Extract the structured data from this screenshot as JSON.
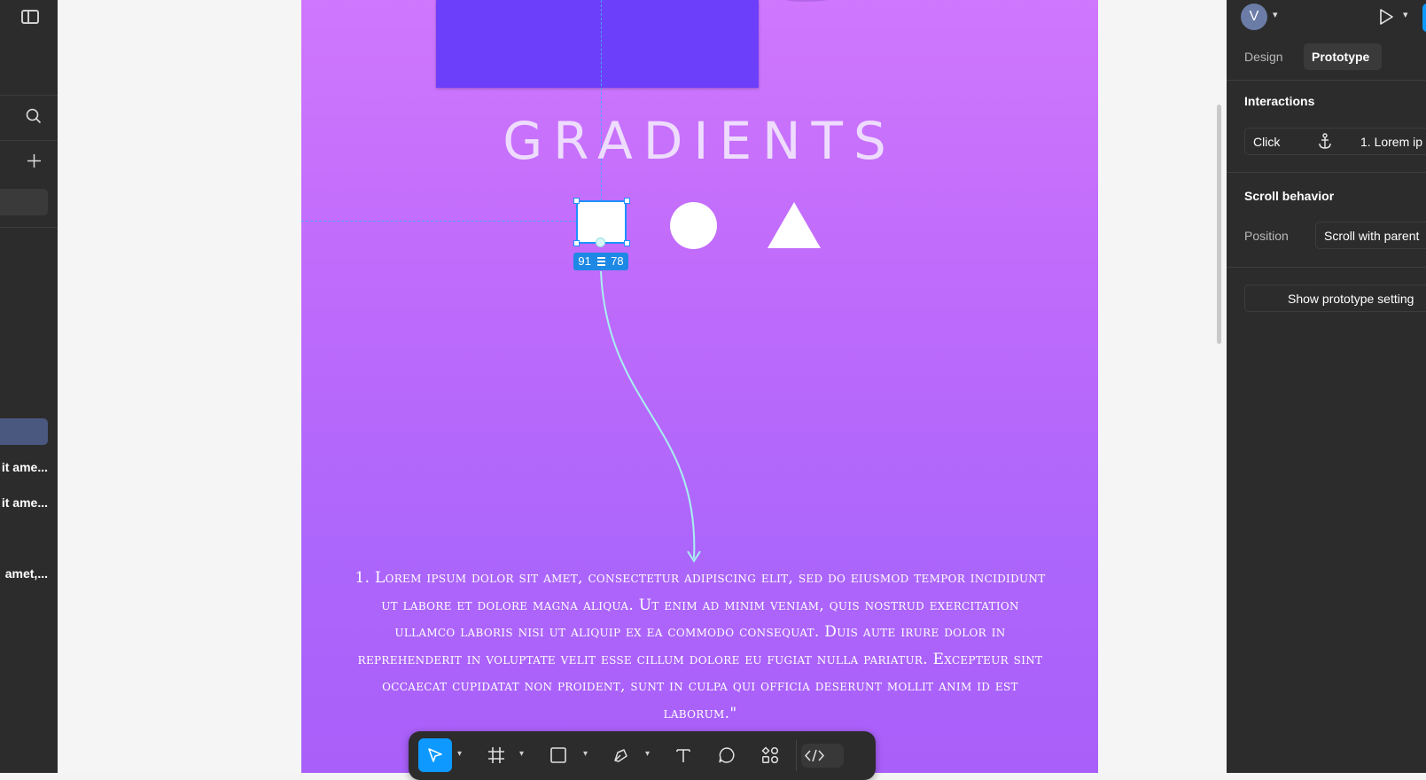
{
  "left_panel": {
    "items": [
      {
        "label": "it ame..."
      },
      {
        "label": "it ame..."
      },
      {
        "label": "amet,..."
      }
    ]
  },
  "canvas": {
    "frame_title": "GRADIENTS",
    "size_badge": {
      "width": "91",
      "height": "78"
    },
    "body_text": "1. Lorem ipsum dolor sit amet, consectetur adipiscing elit, sed do eiusmod tempor incididunt ut labore et dolore magna aliqua. Ut enim ad minim veniam, quis nostrud exercitation ullamco laboris nisi ut aliquip ex ea commodo consequat. Duis aute irure dolor in reprehenderit in voluptate velit esse cillum dolore eu fugiat nulla pariatur. Excepteur sint occaecat cupidatat non proident, sunt in culpa qui officia deserunt mollit anim id est laborum.\""
  },
  "right_panel": {
    "avatar_initial": "V",
    "tabs": [
      {
        "label": "Design"
      },
      {
        "label": "Prototype"
      }
    ],
    "interactions": {
      "title": "Interactions",
      "trigger": "Click",
      "destination": "1. Lorem ip"
    },
    "scroll_behavior": {
      "title": "Scroll behavior",
      "position_label": "Position",
      "position_value": "Scroll with parent"
    },
    "show_settings_label": "Show prototype setting"
  },
  "colors": {
    "accent": "#1e88e5",
    "frame_top": "#cf77fd",
    "frame_bottom": "#a95ff9",
    "rect": "#6c3ffa",
    "connector": "#a8f0f0"
  },
  "toolbar": {
    "tools": [
      "move-icon",
      "frame-icon",
      "rectangle-icon",
      "pen-icon",
      "text-icon",
      "comment-icon",
      "assets-icon",
      "dev-mode-icon"
    ]
  }
}
